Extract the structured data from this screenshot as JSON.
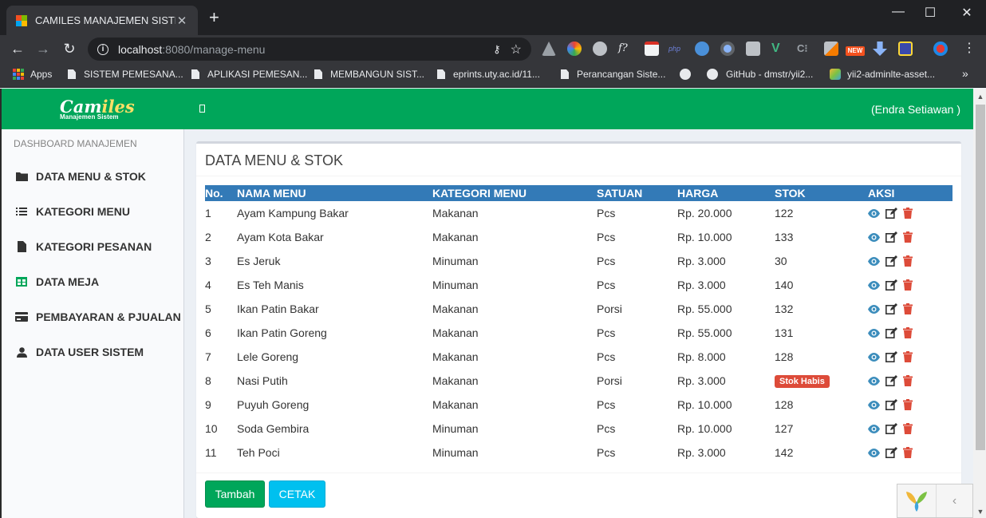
{
  "browser": {
    "tab_title": "CAMILES MANAJEMEN SISTEM",
    "tab_close": "✕",
    "new_tab": "+",
    "window_controls": {
      "minimize": "—",
      "maximize": "☐",
      "close": "✕"
    },
    "url_host": "localhost",
    "url_rest": ":8080/manage-menu",
    "new_badge": "NEW",
    "bookmarks": [
      {
        "label": "Apps",
        "icon": "apps-grid-icon"
      },
      {
        "label": "SISTEM PEMESANA...",
        "icon": "document-icon"
      },
      {
        "label": "APLIKASI PEMESAN...",
        "icon": "document-icon"
      },
      {
        "label": "MEMBANGUN SIST...",
        "icon": "document-icon"
      },
      {
        "label": "eprints.uty.ac.id/11...",
        "icon": "document-icon"
      },
      {
        "label": "Perancangan Siste...",
        "icon": "document-icon"
      },
      {
        "label": "",
        "icon": "globe-icon"
      },
      {
        "label": "GitHub - dmstr/yii2...",
        "icon": "github-icon"
      },
      {
        "label": "yii2-adminlte-asset...",
        "icon": "yii-icon"
      }
    ],
    "more_bookmarks": "»"
  },
  "app": {
    "logo_main_a": "Cam",
    "logo_main_b": "iles",
    "logo_sub": "Manajemen Sistem",
    "user": "(Endra Setiawan )",
    "colors": {
      "brand": "#00a65a",
      "table_header": "#337ab7",
      "danger": "#dd4b39",
      "info": "#00c0ef"
    }
  },
  "sidebar": {
    "header": "DASHBOARD MANAJEMEN",
    "items": [
      {
        "label": "DATA MENU & STOK",
        "icon": "folder-icon"
      },
      {
        "label": "KATEGORI MENU",
        "icon": "list-icon"
      },
      {
        "label": "KATEGORI PESANAN",
        "icon": "file-icon"
      },
      {
        "label": "DATA MEJA",
        "icon": "table-icon"
      },
      {
        "label": "PEMBAYARAN & PJUALAN",
        "icon": "credit-card-icon"
      },
      {
        "label": "DATA USER SISTEM",
        "icon": "user-icon"
      }
    ]
  },
  "main": {
    "title": "DATA MENU & STOK",
    "columns": [
      "No.",
      "NAMA MENU",
      "KATEGORI MENU",
      "SATUAN",
      "HARGA",
      "STOK",
      "AKSI"
    ],
    "rows": [
      {
        "no": "1",
        "nama": "Ayam Kampung Bakar",
        "kategori": "Makanan",
        "satuan": "Pcs",
        "harga": "Rp. 20.000",
        "stok": "122"
      },
      {
        "no": "2",
        "nama": "Ayam Kota Bakar",
        "kategori": "Makanan",
        "satuan": "Pcs",
        "harga": "Rp. 10.000",
        "stok": "133"
      },
      {
        "no": "3",
        "nama": "Es Jeruk",
        "kategori": "Minuman",
        "satuan": "Pcs",
        "harga": "Rp. 3.000",
        "stok": "30"
      },
      {
        "no": "4",
        "nama": "Es Teh Manis",
        "kategori": "Minuman",
        "satuan": "Pcs",
        "harga": "Rp. 3.000",
        "stok": "140"
      },
      {
        "no": "5",
        "nama": "Ikan Patin Bakar",
        "kategori": "Makanan",
        "satuan": "Porsi",
        "harga": "Rp. 55.000",
        "stok": "132"
      },
      {
        "no": "6",
        "nama": "Ikan Patin Goreng",
        "kategori": "Makanan",
        "satuan": "Pcs",
        "harga": "Rp. 55.000",
        "stok": "131"
      },
      {
        "no": "7",
        "nama": "Lele Goreng",
        "kategori": "Makanan",
        "satuan": "Pcs",
        "harga": "Rp. 8.000",
        "stok": "128"
      },
      {
        "no": "8",
        "nama": "Nasi Putih",
        "kategori": "Makanan",
        "satuan": "Porsi",
        "harga": "Rp. 3.000",
        "stok": "",
        "stok_badge": "Stok Habis"
      },
      {
        "no": "9",
        "nama": "Puyuh Goreng",
        "kategori": "Makanan",
        "satuan": "Pcs",
        "harga": "Rp. 10.000",
        "stok": "128"
      },
      {
        "no": "10",
        "nama": "Soda Gembira",
        "kategori": "Minuman",
        "satuan": "Pcs",
        "harga": "Rp. 10.000",
        "stok": "127"
      },
      {
        "no": "11",
        "nama": "Teh Poci",
        "kategori": "Minuman",
        "satuan": "Pcs",
        "harga": "Rp. 3.000",
        "stok": "142"
      }
    ],
    "actions": [
      "eye-icon",
      "edit-icon",
      "trash-icon"
    ],
    "btn_add": "Tambah",
    "btn_print": "CETAK"
  },
  "debug_toolbar": {
    "chevron": "‹"
  }
}
